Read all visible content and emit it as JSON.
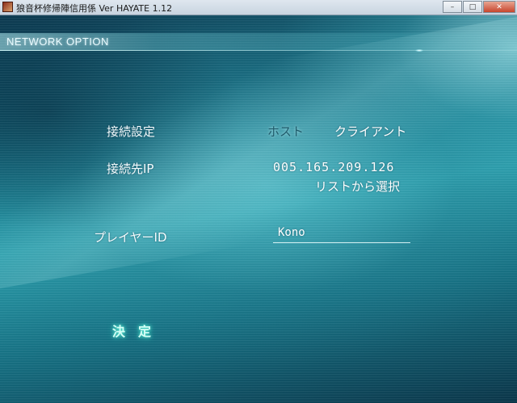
{
  "window": {
    "title": "狼音杯修帰陣信用係 Ver HAYATE 1.12",
    "controls": {
      "minimize": "–",
      "maximize": "□",
      "close": "✕"
    }
  },
  "header": {
    "title": "NETWORK OPTION"
  },
  "settings": {
    "connection_label": "接続設定",
    "host_option": "ホスト",
    "client_option": "クライアント",
    "target_ip_label": "接続先IP",
    "target_ip_value": "005.165.209.126",
    "select_from_list": "リストから選択",
    "player_id_label": "プレイヤーID",
    "player_id_value": "Kono"
  },
  "actions": {
    "confirm_label": "決定"
  },
  "colors": {
    "background_primary": "#17788c",
    "background_dark": "#083448",
    "text": "#f4fbfd",
    "selected_option": "#1f5a6a",
    "confirm_glow": "#5ff0d8"
  },
  "icons": {
    "app": "app-icon"
  }
}
